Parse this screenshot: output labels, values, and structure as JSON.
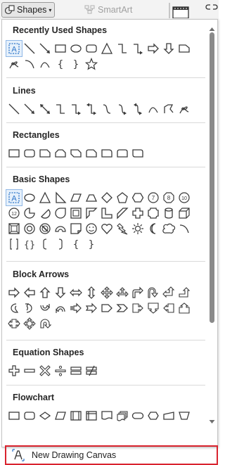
{
  "toolbar": {
    "shapes_label": "Shapes",
    "smartart_label": "SmartArt"
  },
  "gallery": {
    "sections": [
      {
        "title": "Recently Used Shapes"
      },
      {
        "title": "Lines"
      },
      {
        "title": "Rectangles"
      },
      {
        "title": "Basic Shapes"
      },
      {
        "title": "Block Arrows"
      },
      {
        "title": "Equation Shapes"
      },
      {
        "title": "Flowchart"
      }
    ]
  },
  "footer": {
    "new_canvas_label": "New Drawing Canvas"
  },
  "colors": {
    "shape_stroke": "#3a3a3a",
    "selected_accent": "#2b73c8",
    "highlight_border": "#d9232e"
  }
}
